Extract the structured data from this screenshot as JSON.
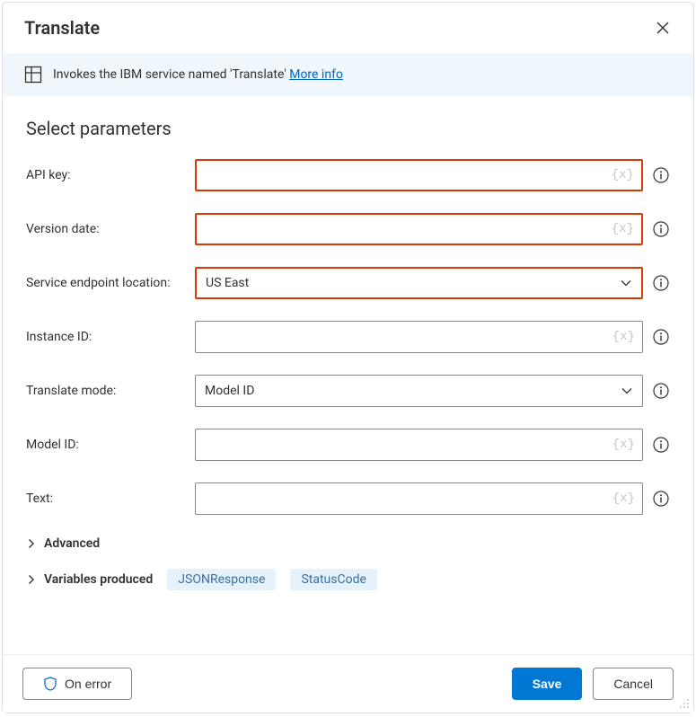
{
  "header": {
    "title": "Translate"
  },
  "banner": {
    "text_prefix": "Invokes the IBM service named 'Translate' ",
    "link_text": "More info"
  },
  "section": {
    "title": "Select parameters"
  },
  "fields": {
    "api_key": {
      "label": "API key:",
      "value": "",
      "token": "{x}",
      "invalid": true,
      "type": "text"
    },
    "version": {
      "label": "Version date:",
      "value": "",
      "token": "{x}",
      "invalid": true,
      "type": "text"
    },
    "endpoint": {
      "label": "Service endpoint location:",
      "value": "US East",
      "invalid": true,
      "type": "select"
    },
    "instance": {
      "label": "Instance ID:",
      "value": "",
      "token": "{x}",
      "invalid": false,
      "type": "text"
    },
    "mode": {
      "label": "Translate mode:",
      "value": "Model ID",
      "invalid": false,
      "type": "select"
    },
    "model_id": {
      "label": "Model ID:",
      "value": "",
      "token": "{x}",
      "invalid": false,
      "type": "text"
    },
    "text": {
      "label": "Text:",
      "value": "",
      "token": "{x}",
      "invalid": false,
      "type": "text"
    }
  },
  "expanders": {
    "advanced": {
      "label": "Advanced"
    },
    "variables": {
      "label": "Variables produced",
      "pills": [
        "JSONResponse",
        "StatusCode"
      ]
    }
  },
  "footer": {
    "on_error": "On error",
    "save": "Save",
    "cancel": "Cancel"
  }
}
